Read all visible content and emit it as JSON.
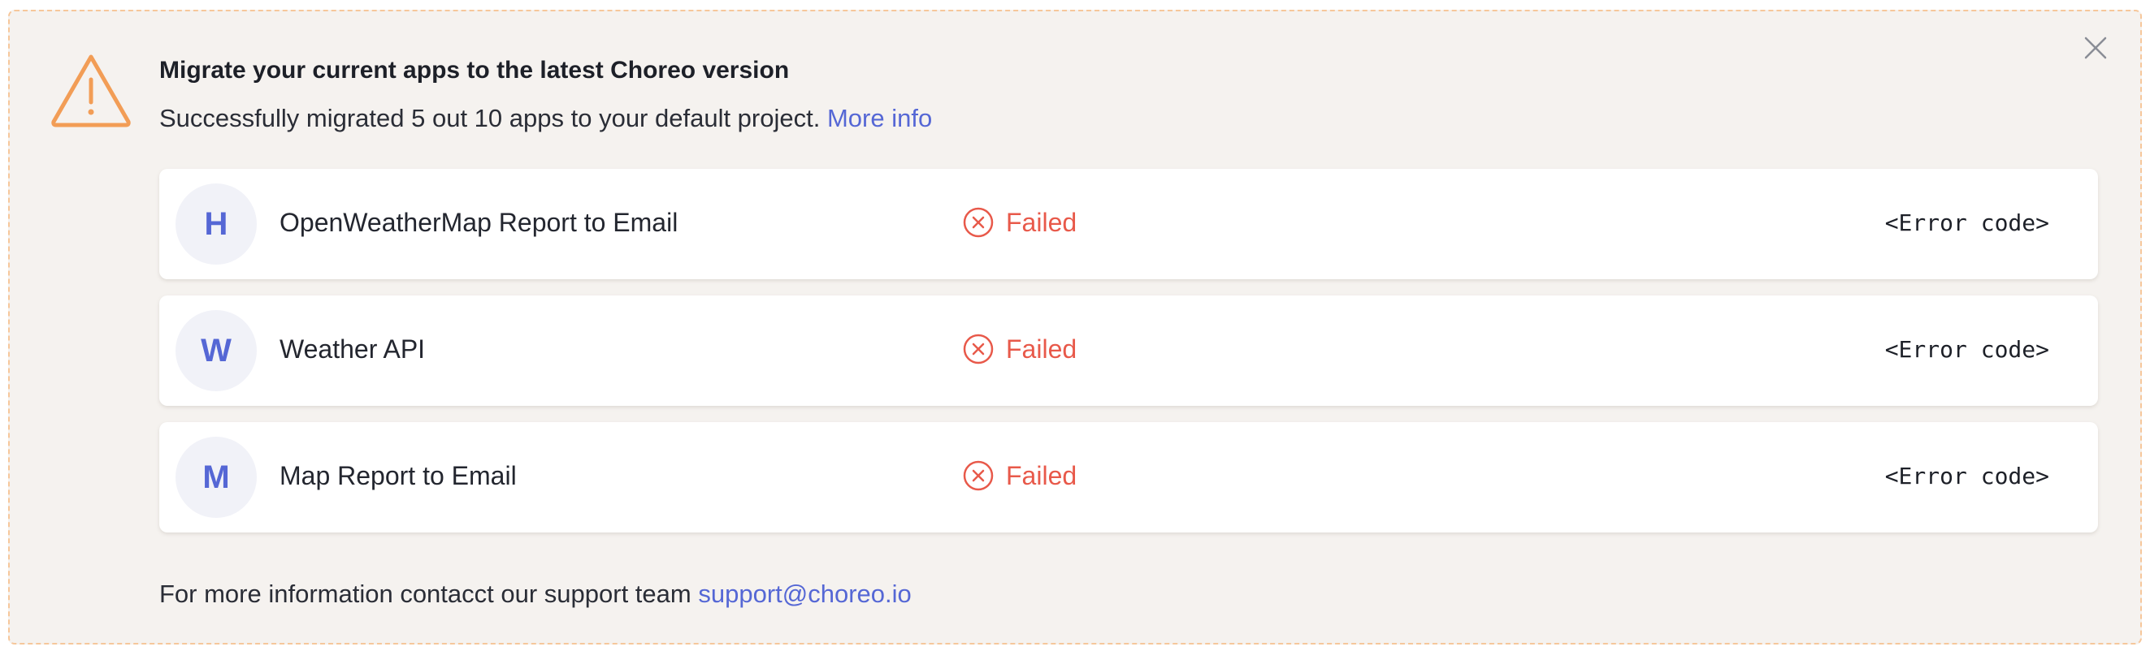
{
  "banner": {
    "title": "Migrate your current apps to the latest Choreo version",
    "message": "Successfully migrated 5 out 10 apps to your default project.",
    "more_info_label": "More info",
    "colors": {
      "background": "#f5f2ef",
      "border": "#f6c79b",
      "warning": "#f29d56",
      "link": "#5567d5",
      "failed": "#e8594a"
    },
    "icons": {
      "warning": "warning-triangle-icon",
      "close": "close-icon",
      "status": "x-circle-icon"
    }
  },
  "apps": [
    {
      "initial": "H",
      "name": "OpenWeatherMap Report to Email",
      "status": "Failed",
      "error": "<Error code>"
    },
    {
      "initial": "W",
      "name": "Weather API",
      "status": "Failed",
      "error": "<Error code>"
    },
    {
      "initial": "M",
      "name": "Map Report to Email",
      "status": "Failed",
      "error": "<Error code>"
    }
  ],
  "footer": {
    "text": "For more information contacct our support team",
    "email": "support@choreo.io"
  }
}
